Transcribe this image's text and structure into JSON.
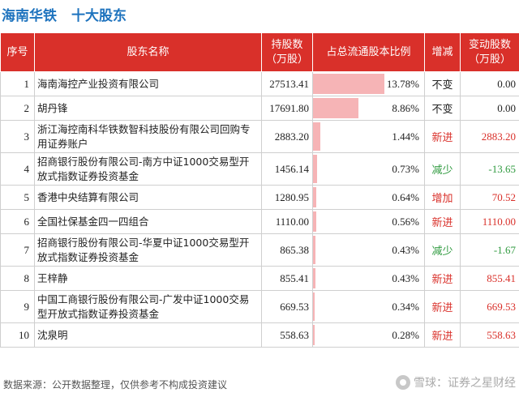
{
  "title": {
    "company": "海南华铁",
    "sub": "十大股东"
  },
  "headers": {
    "idx": "序号",
    "name": "股东名称",
    "shares_line1": "持股数",
    "shares_line2": "（万股）",
    "ratio": "占总流通股本比例",
    "change": "增减",
    "delta_line1": "变动股数",
    "delta_line2": "（万股）"
  },
  "colors": {
    "header_bg": "#d9302a",
    "bar": "#f6b4b6",
    "up": "#d9302a",
    "down": "#2f9a3f",
    "title": "#1e73be"
  },
  "rows": [
    {
      "idx": "1",
      "name": "海南海控产业投资有限公司",
      "shares": "27513.41",
      "ratio": "13.78%",
      "ratio_value": 13.78,
      "change": "不变",
      "change_type": "neutral",
      "delta": "0.00"
    },
    {
      "idx": "2",
      "name": "胡丹锋",
      "shares": "17691.80",
      "ratio": "8.86%",
      "ratio_value": 8.86,
      "change": "不变",
      "change_type": "neutral",
      "delta": "0.00"
    },
    {
      "idx": "3",
      "name": "浙江海控南科华铁数智科技股份有限公司回购专用证券账户",
      "shares": "2883.20",
      "ratio": "1.44%",
      "ratio_value": 1.44,
      "change": "新进",
      "change_type": "up",
      "delta": "2883.20"
    },
    {
      "idx": "4",
      "name": "招商银行股份有限公司-南方中证1000交易型开放式指数证券投资基金",
      "shares": "1456.14",
      "ratio": "0.73%",
      "ratio_value": 0.73,
      "change": "减少",
      "change_type": "down",
      "delta": "-13.65"
    },
    {
      "idx": "5",
      "name": "香港中央结算有限公司",
      "shares": "1280.95",
      "ratio": "0.64%",
      "ratio_value": 0.64,
      "change": "增加",
      "change_type": "up",
      "delta": "70.52"
    },
    {
      "idx": "6",
      "name": "全国社保基金四一四组合",
      "shares": "1110.00",
      "ratio": "0.56%",
      "ratio_value": 0.56,
      "change": "新进",
      "change_type": "up",
      "delta": "1110.00"
    },
    {
      "idx": "7",
      "name": "招商银行股份有限公司-华夏中证1000交易型开放式指数证券投资基金",
      "shares": "865.38",
      "ratio": "0.43%",
      "ratio_value": 0.43,
      "change": "减少",
      "change_type": "down",
      "delta": "-1.67"
    },
    {
      "idx": "8",
      "name": "王梓静",
      "shares": "855.41",
      "ratio": "0.43%",
      "ratio_value": 0.43,
      "change": "新进",
      "change_type": "up",
      "delta": "855.41"
    },
    {
      "idx": "9",
      "name": "中国工商银行股份有限公司-广发中证1000交易型开放式指数证券投资基金",
      "shares": "669.53",
      "ratio": "0.34%",
      "ratio_value": 0.34,
      "change": "新进",
      "change_type": "up",
      "delta": "669.53"
    },
    {
      "idx": "10",
      "name": "沈泉明",
      "shares": "558.63",
      "ratio": "0.28%",
      "ratio_value": 0.28,
      "change": "新进",
      "change_type": "up",
      "delta": "558.63"
    }
  ],
  "footer": {
    "source": "数据来源：公开数据整理，仅供参考不构成投资建议"
  },
  "brand": {
    "text": "雪球：证券之星财经",
    "icon": "snowball-logo-icon"
  }
}
